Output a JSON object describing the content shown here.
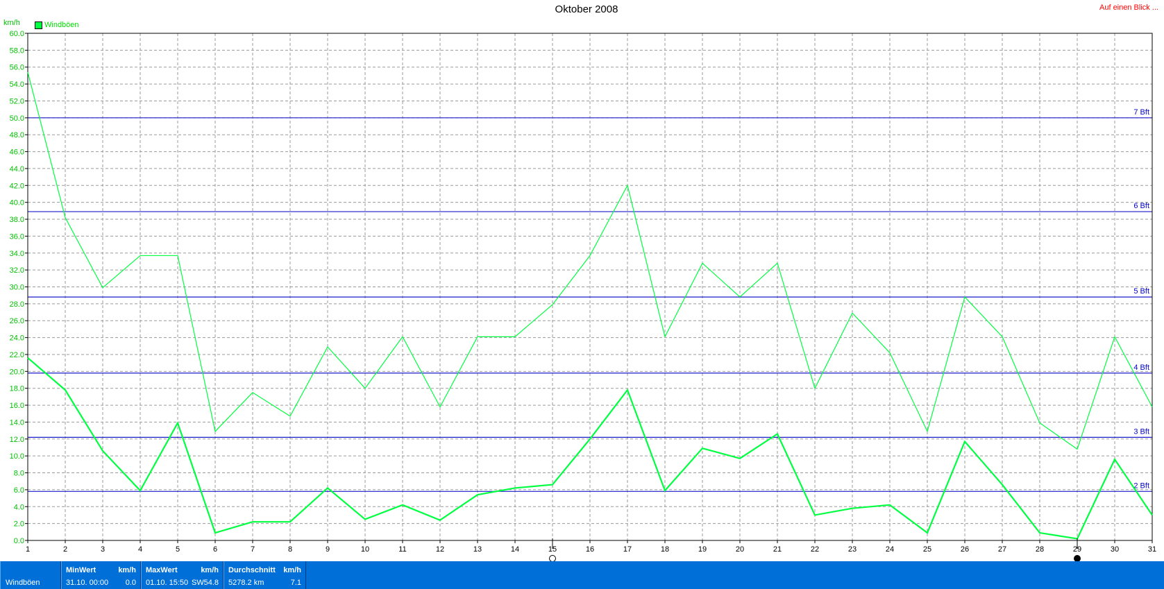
{
  "title": "Oktober 2008",
  "link_text": "Auf einen Blick ...",
  "unit_label": "km/h",
  "legend": {
    "label": "Windböen",
    "color": "#00ff40"
  },
  "chart_data": {
    "type": "line",
    "title": "Oktober 2008",
    "ylabel": "km/h",
    "xlabel": "",
    "ylim": [
      0,
      60
    ],
    "xlim": [
      1,
      31
    ],
    "y_ticks": [
      "0.0",
      "2.0",
      "4.0",
      "6.0",
      "8.0",
      "10.0",
      "12.0",
      "14.0",
      "16.0",
      "18.0",
      "20.0",
      "22.0",
      "24.0",
      "26.0",
      "28.0",
      "30.0",
      "32.0",
      "34.0",
      "36.0",
      "38.0",
      "40.0",
      "42.0",
      "44.0",
      "46.0",
      "48.0",
      "50.0",
      "52.0",
      "54.0",
      "56.0",
      "58.0",
      "60.0"
    ],
    "x": [
      1,
      2,
      3,
      4,
      5,
      6,
      7,
      8,
      9,
      10,
      11,
      12,
      13,
      14,
      15,
      16,
      17,
      18,
      19,
      20,
      21,
      22,
      23,
      24,
      25,
      26,
      27,
      28,
      29,
      30,
      31
    ],
    "grid": true,
    "series": [
      {
        "name": "Windböen",
        "values": [
          55.4,
          38.2,
          29.9,
          33.7,
          33.7,
          12.9,
          17.5,
          14.7,
          22.9,
          18.0,
          24.1,
          15.8,
          24.1,
          24.1,
          27.9,
          33.7,
          42.0,
          24.1,
          32.8,
          28.8,
          32.8,
          18.0,
          26.9,
          22.2,
          12.9,
          28.8,
          24.1,
          13.9,
          10.8,
          24.1,
          15.8
        ],
        "color": "#00ff40"
      },
      {
        "values": [
          21.6,
          17.8,
          10.6,
          5.9,
          13.9,
          0.9,
          2.2,
          2.2,
          6.2,
          2.5,
          4.2,
          2.4,
          5.4,
          6.2,
          6.6,
          12.0,
          17.8,
          5.9,
          10.9,
          9.7,
          12.6,
          3.0,
          3.8,
          4.2,
          0.9,
          11.7,
          6.6,
          0.9,
          0.2,
          9.6,
          3.0
        ],
        "color": "#00ff40"
      }
    ],
    "reference_lines": [
      {
        "label": "2 Bft",
        "value": 5.8
      },
      {
        "label": "3 Bft",
        "value": 12.2
      },
      {
        "label": "4 Bft",
        "value": 19.8
      },
      {
        "label": "5 Bft",
        "value": 28.8
      },
      {
        "label": "6 Bft",
        "value": 38.9
      },
      {
        "label": "7 Bft",
        "value": 50.0
      }
    ],
    "moon_markers": [
      {
        "day": 15,
        "phase": "full-moon"
      },
      {
        "day": 29,
        "phase": "new-moon"
      }
    ]
  },
  "status": {
    "name": "Windböen",
    "min": {
      "header": "MinWert",
      "unit": "km/h",
      "time": "31.10.  00:00",
      "value": "0.0"
    },
    "max": {
      "header": "MaxWert",
      "unit": "km/h",
      "time": "01.10.  15:50",
      "dir": "SW",
      "value": "54.8"
    },
    "avg": {
      "header": "Durchschnitt",
      "unit": "km/h",
      "dist": "5278.2 km",
      "value": "7.1"
    }
  }
}
